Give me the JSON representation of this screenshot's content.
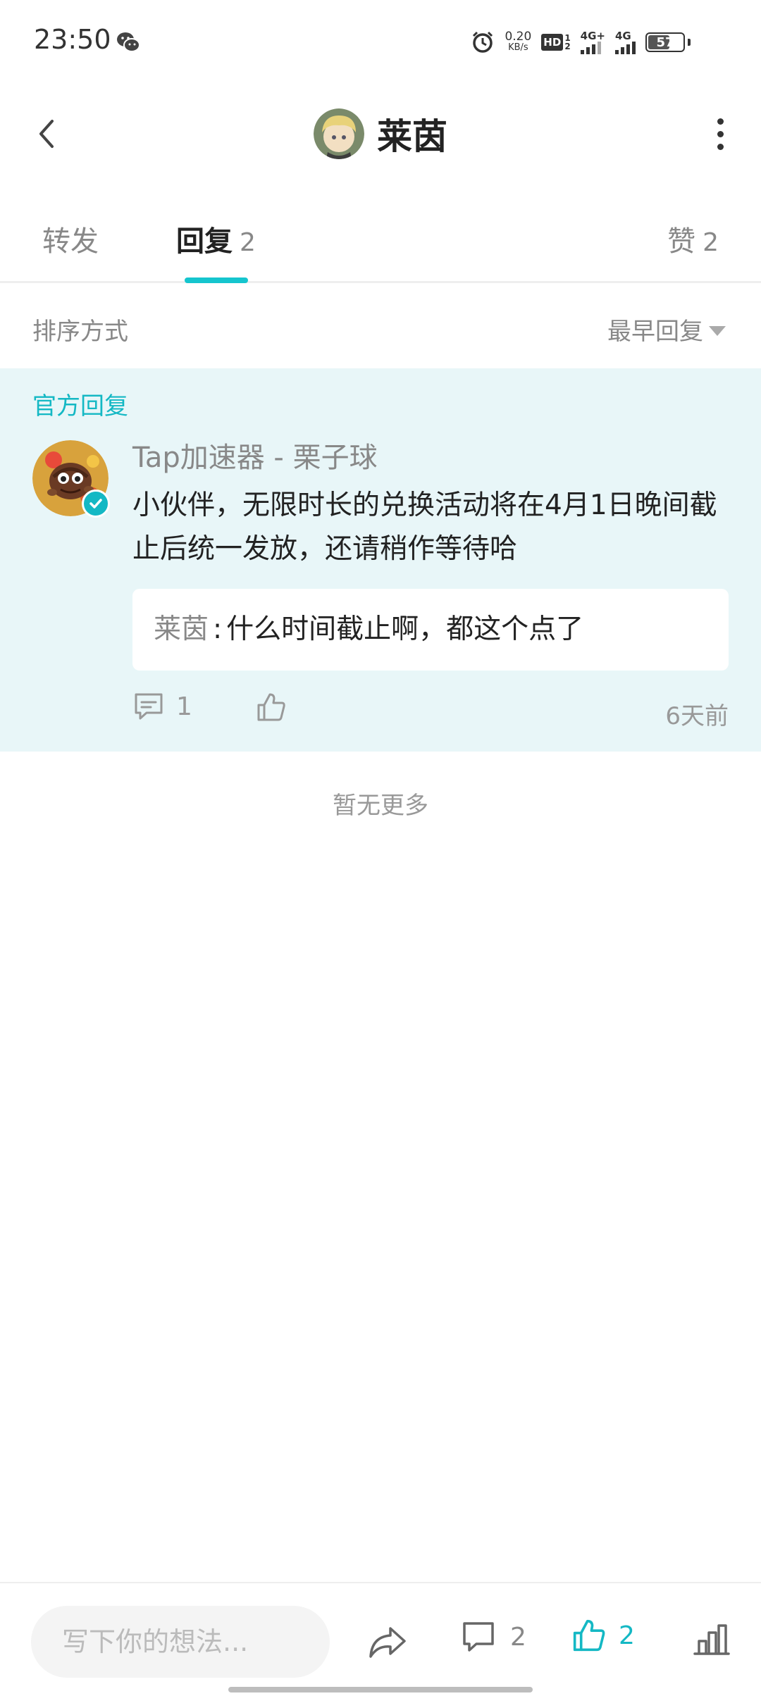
{
  "status_bar": {
    "time": "23:50",
    "net_speed_value": "0.20",
    "net_speed_unit": "KB/s",
    "hd_label": "HD",
    "hd_sim1": "1",
    "hd_sim2": "2",
    "signal1_label": "4G+",
    "signal2_label": "4G",
    "battery_level": "57",
    "icons": [
      "wechat-icon",
      "alarm-icon",
      "signal-icon",
      "battery-icon"
    ]
  },
  "header": {
    "title": "莱茵",
    "back_icon": "chevron-left-icon",
    "more_icon": "more-vertical-icon"
  },
  "tabs": [
    {
      "label": "转发",
      "count": ""
    },
    {
      "label": "回复",
      "count": "2",
      "active": true
    },
    {
      "label": "赞",
      "count": "2"
    }
  ],
  "sort": {
    "label": "排序方式",
    "selected": "最早回复"
  },
  "official_reply": {
    "badge_label": "官方回复",
    "author": "Tap加速器 - 栗子球",
    "content": "小伙伴，无限时长的兑换活动将在4月1日晚间截止后统一发放，还请稍作等待哈",
    "quote": {
      "name": "莱茵",
      "separator": ":",
      "text": "什么时间截止啊，都这个点了"
    },
    "comment_count": "1",
    "time": "6天前",
    "accent_color": "#14b8c4"
  },
  "no_more_text": "暂无更多",
  "bottom_bar": {
    "input_placeholder": "写下你的想法...",
    "comment_count": "2",
    "like_count": "2",
    "like_color": "#14b8c4"
  }
}
